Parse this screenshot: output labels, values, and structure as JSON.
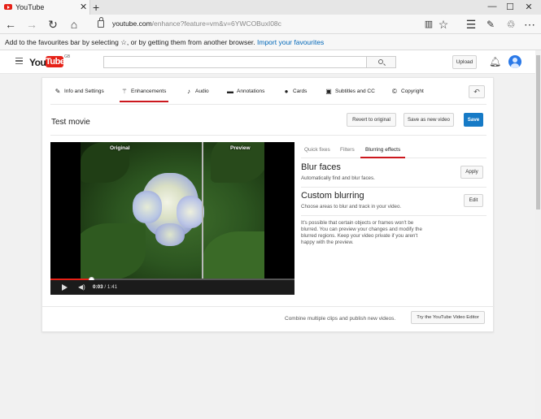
{
  "browser": {
    "tab_title": "YouTube",
    "tab_close": "✕",
    "new_tab": "+",
    "window_controls": [
      "—",
      "☐",
      "✕"
    ],
    "url_host": "youtube.com",
    "url_path": "/enhance?feature=vm&v=6YWCOBuxI08c",
    "nav_icons": [
      "back-icon",
      "forward-icon",
      "refresh-icon",
      "home-icon"
    ],
    "toolbar_icons": [
      "reading-view-icon",
      "favorite-star-icon",
      "hub-icon",
      "web-note-icon",
      "share-icon",
      "more-icon"
    ],
    "favourites_message": "Add to the favourites bar by selecting ☆, or by getting them from another browser.",
    "favourites_link": "Import your favourites"
  },
  "masthead": {
    "logo_you": "You",
    "logo_tube": "Tube",
    "logo_region": "GB",
    "search_value": "",
    "upload_label": "Upload",
    "brand_color": "#e62117"
  },
  "editor": {
    "tabs": [
      {
        "label": "Info and Settings",
        "icon": "pencil-icon",
        "active": false
      },
      {
        "label": "Enhancements",
        "icon": "magic-wand-icon",
        "active": true
      },
      {
        "label": "Audio",
        "icon": "music-note-icon",
        "active": false
      },
      {
        "label": "Annotations",
        "icon": "speech-bubble-icon",
        "active": false
      },
      {
        "label": "Cards",
        "icon": "info-circle-icon",
        "active": false
      },
      {
        "label": "Subtitles and CC",
        "icon": "cc-icon",
        "active": false
      },
      {
        "label": "Copyright",
        "icon": "copyright-icon",
        "active": false
      }
    ],
    "video_title": "Test movie",
    "revert_label": "Revert to original",
    "save_new_label": "Save as new video",
    "save_label": "Save",
    "accent_color": "#167ac6"
  },
  "player": {
    "original_label": "Original",
    "preview_label": "Preview",
    "current_time": "0:03",
    "duration": "1:41",
    "progress_fraction": 0.03
  },
  "panel": {
    "tabs": [
      {
        "label": "Quick fixes",
        "active": false
      },
      {
        "label": "Filters",
        "active": false
      },
      {
        "label": "Blurring effects",
        "active": true
      }
    ],
    "blur_faces_title": "Blur faces",
    "blur_faces_desc": "Automatically find and blur faces.",
    "apply_label": "Apply",
    "custom_title": "Custom blurring",
    "custom_desc": "Choose areas to blur and track in your video.",
    "edit_label": "Edit",
    "note": "It's possible that certain objects or frames won't be blurred. You can preview your changes and modify the blurred regions. Keep your video private if you aren't happy with the preview."
  },
  "footer": {
    "combine_text": "Combine multiple clips and publish new videos.",
    "editor_button": "Try the YouTube Video Editor"
  }
}
